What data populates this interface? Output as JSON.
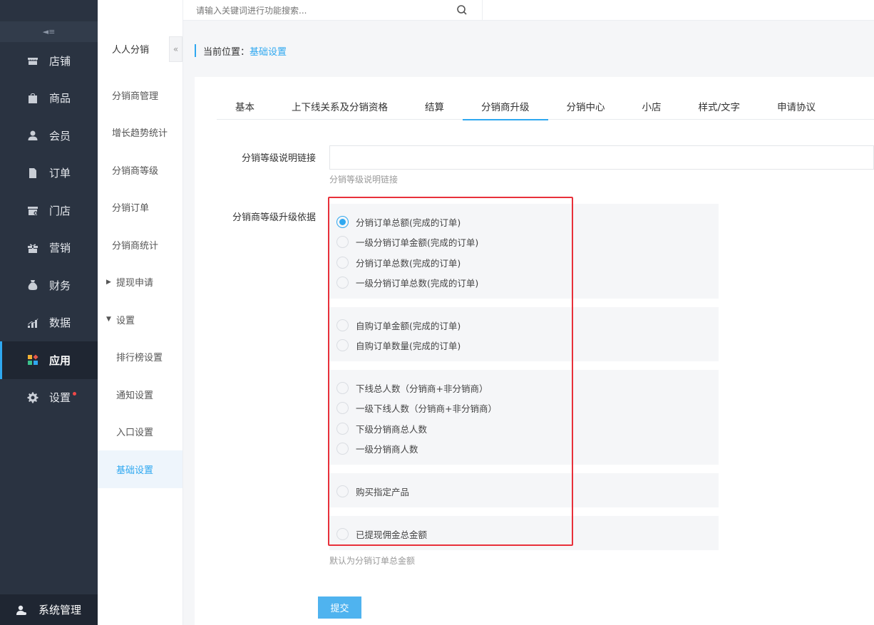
{
  "topbar": {
    "search_placeholder": "请输入关键词进行功能搜索..."
  },
  "sidebar": {
    "items": [
      {
        "label": "店铺",
        "icon": "store-icon"
      },
      {
        "label": "商品",
        "icon": "bag-icon"
      },
      {
        "label": "会员",
        "icon": "user-icon"
      },
      {
        "label": "订单",
        "icon": "document-icon"
      },
      {
        "label": "门店",
        "icon": "shop-icon"
      },
      {
        "label": "营销",
        "icon": "gift-icon"
      },
      {
        "label": "财务",
        "icon": "money-bag-icon"
      },
      {
        "label": "数据",
        "icon": "chart-icon"
      },
      {
        "label": "应用",
        "icon": "apps-icon",
        "active": true
      },
      {
        "label": "设置",
        "icon": "gear-icon",
        "badge": true
      }
    ],
    "system": "系统管理"
  },
  "subnav": {
    "title": "人人分销",
    "items": [
      {
        "label": "分销商管理"
      },
      {
        "label": "增长趋势统计"
      },
      {
        "label": "分销商等级"
      },
      {
        "label": "分销订单"
      },
      {
        "label": "分销商统计"
      },
      {
        "label": "提现申请",
        "group": "collapsed"
      },
      {
        "label": "设置",
        "group": "expanded"
      },
      {
        "label": "排行榜设置",
        "child": true
      },
      {
        "label": "通知设置",
        "child": true
      },
      {
        "label": "入口设置",
        "child": true
      },
      {
        "label": "基础设置",
        "child": true,
        "active": true
      }
    ]
  },
  "breadcrumb": {
    "prefix": "当前位置：",
    "current": "基础设置"
  },
  "tabs": [
    "基本",
    "上下线关系及分销资格",
    "结算",
    "分销商升级",
    "分销中心",
    "小店",
    "样式/文字",
    "申请协议"
  ],
  "active_tab": "分销商升级",
  "form": {
    "link_label": "分销等级说明链接",
    "link_value": "",
    "link_help": "分销等级说明链接",
    "basis_label": "分销商等级升级依据",
    "basis_help": "默认为分销订单总金额",
    "groups": [
      [
        "分销订单总额(完成的订单)",
        "一级分销订单金额(完成的订单)",
        "分销订单总数(完成的订单)",
        "一级分销订单总数(完成的订单)"
      ],
      [
        "自购订单金额(完成的订单)",
        "自购订单数量(完成的订单)"
      ],
      [
        "下线总人数（分销商+非分销商）",
        "一级下线人数（分销商+非分销商）",
        "下级分销商总人数",
        "一级分销商人数"
      ],
      [
        "购买指定产品"
      ],
      [
        "已提现佣金总金额"
      ]
    ],
    "selected": "分销订单总额(完成的订单)",
    "submit_label": "提交"
  },
  "colors": {
    "accent": "#2fa8f0",
    "sidebar_bg": "#2a3341",
    "highlight_border": "#e8303a"
  }
}
